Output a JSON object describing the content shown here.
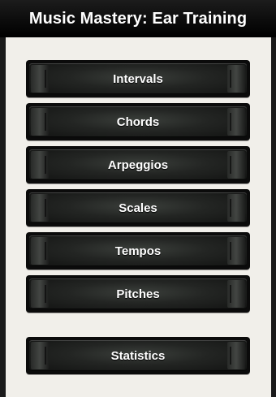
{
  "app": {
    "title": "Music Mastery: Ear Training"
  },
  "menu": {
    "items": [
      {
        "label": "Intervals"
      },
      {
        "label": "Chords"
      },
      {
        "label": "Arpeggios"
      },
      {
        "label": "Scales"
      },
      {
        "label": "Tempos"
      },
      {
        "label": "Pitches"
      }
    ],
    "statistics_label": "Statistics"
  },
  "colors": {
    "titlebar": "#000000",
    "background": "#f1efea",
    "button": "#1b1c1b",
    "button_text": "#ffffff"
  }
}
